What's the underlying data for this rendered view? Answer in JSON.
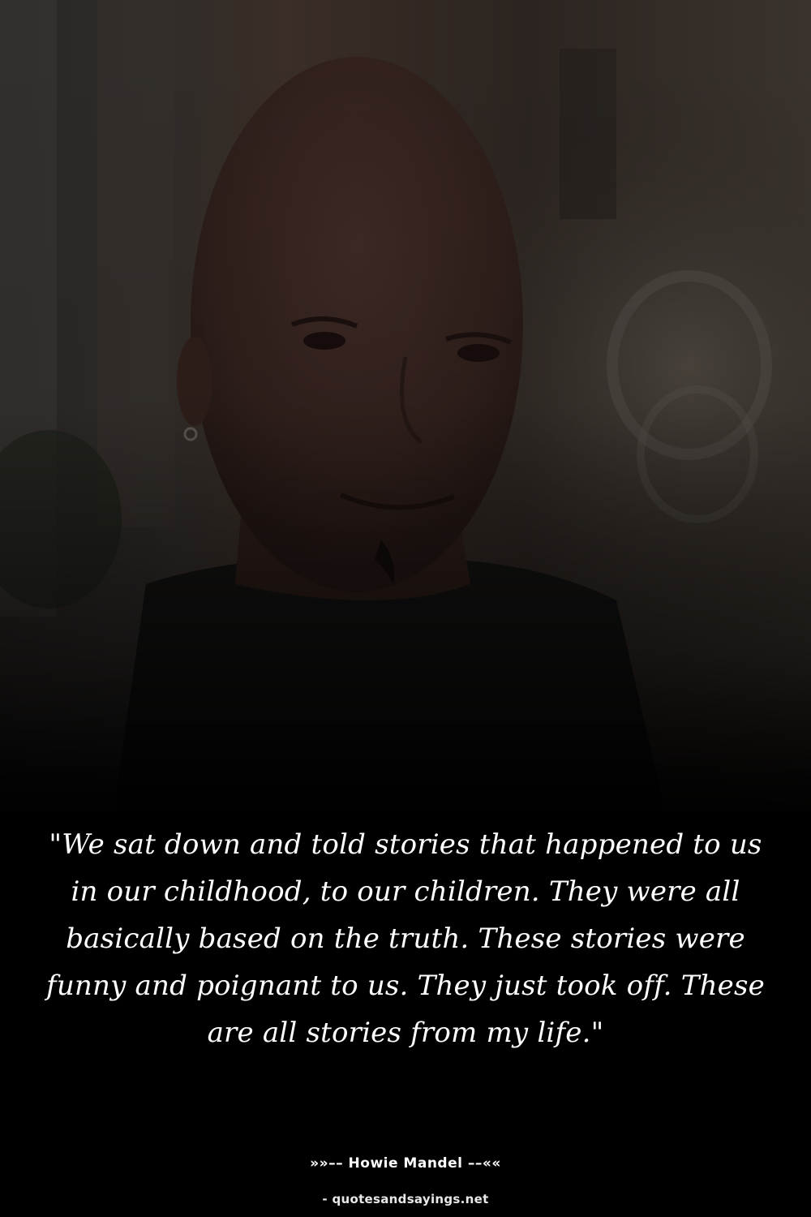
{
  "quote": {
    "text": "\"We sat down and told stories that happened to us in our childhood, to our children. They were all basically based on the truth. These stories were funny and poignant to us. They just took off. These are all stories from my life.\""
  },
  "author": {
    "line": "»»–– Howie Mandel ––««"
  },
  "source": {
    "line": "- quotesandsayings.net"
  },
  "colors": {
    "background": "#000000",
    "text": "#ffffff"
  }
}
